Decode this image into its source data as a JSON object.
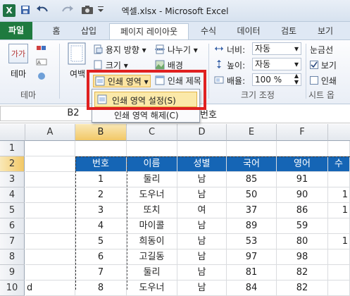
{
  "window": {
    "title": "엑셀.xlsx - Microsoft Excel",
    "app_letter": "X"
  },
  "tabs": [
    {
      "label": "파일"
    },
    {
      "label": "홈"
    },
    {
      "label": "삽입"
    },
    {
      "label": "페이지 레이아웃"
    },
    {
      "label": "수식"
    },
    {
      "label": "데이터"
    },
    {
      "label": "검토"
    },
    {
      "label": "보기"
    }
  ],
  "ribbon": {
    "theme": {
      "icon_text": "가가",
      "label": "테마",
      "group_label": "테마"
    },
    "margins": {
      "label": "여백"
    },
    "orientation": "용지 방향",
    "breaks": "나누기",
    "size": "크기",
    "background": "배경",
    "print_area": "인쇄 영역",
    "print_titles": "인쇄 제목",
    "width_label": "너비:",
    "width_value": "자동",
    "height_label": "높이:",
    "height_value": "자동",
    "scale_label": "배율:",
    "scale_value": "100 %",
    "scale_group_label": "크기 조정",
    "gridlines": "눈금선",
    "view": "보기",
    "print": "인쇄",
    "sheet_options_label": "시트 옵"
  },
  "menu": {
    "set_print_area": "인쇄 영역 설정(S)",
    "clear_print_area": "인쇄 영역 해제(C)"
  },
  "formula_bar": {
    "name_box": "B2",
    "content": "번호"
  },
  "columns": [
    "A",
    "B",
    "C",
    "D",
    "E",
    "F",
    ""
  ],
  "rows": [
    "1",
    "2",
    "3",
    "4",
    "5",
    "6",
    "7",
    "8",
    "9",
    "10"
  ],
  "table": {
    "headers": [
      "번호",
      "이름",
      "성별",
      "국어",
      "영어",
      "수"
    ],
    "data": [
      [
        "1",
        "둘리",
        "남",
        "85",
        "91",
        ""
      ],
      [
        "2",
        "도우너",
        "남",
        "50",
        "90",
        "1"
      ],
      [
        "3",
        "또치",
        "여",
        "37",
        "86",
        "1"
      ],
      [
        "4",
        "마이콜",
        "남",
        "89",
        "59",
        ""
      ],
      [
        "5",
        "희동이",
        "남",
        "53",
        "80",
        "1"
      ],
      [
        "6",
        "고길동",
        "남",
        "97",
        "98",
        ""
      ],
      [
        "7",
        "둘리",
        "남",
        "81",
        "82",
        ""
      ],
      [
        "8",
        "도우너",
        "남",
        "84",
        "82",
        ""
      ]
    ],
    "row10_a": "d"
  },
  "colors": {
    "file_tab": "#1f7a3f",
    "header_fill": "#1565b5",
    "highlight_box": "#e02020",
    "menu_hover": "#fbe9a9"
  }
}
